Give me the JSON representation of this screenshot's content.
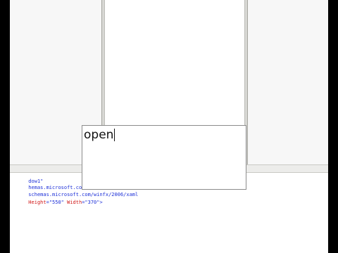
{
  "overlay": {
    "typed_text": "open"
  },
  "xaml_editor": {
    "lines": [
      {
        "text": "dow1\""
      },
      {
        "text": "hemas.microsoft.com/wi"
      },
      {
        "text": "schemas.microsoft.com/winfx/2006/xaml"
      },
      {
        "attr": "Height",
        "eq": "=",
        "val": "\"550\"",
        "attr2": "Width",
        "eq2": "=",
        "val2": "\"370\"",
        "tail": ">"
      }
    ]
  },
  "colors": {
    "xaml_value": "#1c2fd8",
    "xaml_attribute": "#d11a1a",
    "designer_background": "#f7f7f7"
  }
}
